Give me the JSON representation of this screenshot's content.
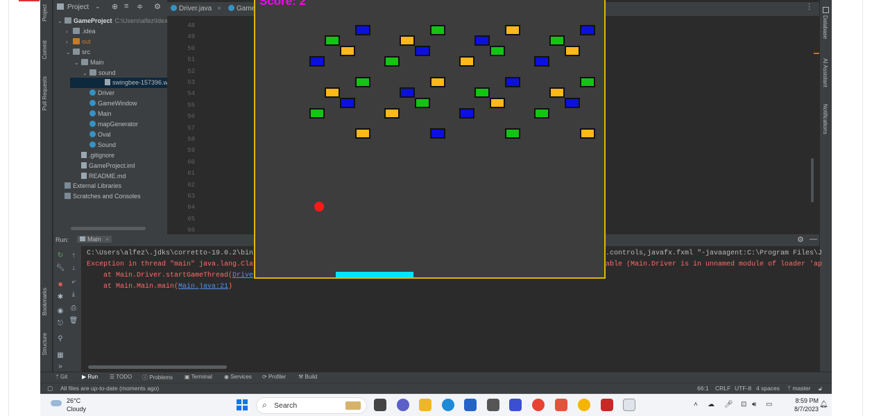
{
  "colors": {
    "game_border": "#e0b800",
    "score": "#ff00ff",
    "ball": "#ff1a1a",
    "paddle": "#00e5ff",
    "brick_blue": "#0b10e0",
    "brick_green": "#14c414",
    "brick_yellow": "#ffb81a"
  },
  "left_strip": {
    "project": "Project",
    "commit": "Commit",
    "pull_requests": "Pull Requests",
    "bookmarks": "Bookmarks",
    "structure": "Structure"
  },
  "right_strip": {
    "database": "Database",
    "ai_assistant": "AI Assistant",
    "notifications": "Notifications"
  },
  "project_panel": {
    "title": "Project",
    "rows": [
      {
        "label": "GameProject",
        "extra": "C:\\Users\\alfez\\IdeaPro",
        "icon": "folder-icon"
      },
      {
        "label": ".idea",
        "icon": "folder-icon"
      },
      {
        "label": "out",
        "icon": "folder-icon"
      },
      {
        "label": "src",
        "icon": "folder-icon"
      },
      {
        "label": "Main",
        "icon": "folder-icon"
      },
      {
        "label": "sound",
        "icon": "folder-icon"
      },
      {
        "label": "swingbee-157396.wav",
        "icon": "file-icon"
      },
      {
        "label": "Driver",
        "icon": "class-icon"
      },
      {
        "label": "GameWindow",
        "icon": "class-icon"
      },
      {
        "label": "Main",
        "icon": "class-icon"
      },
      {
        "label": "mapGenerator",
        "icon": "class-icon"
      },
      {
        "label": "Oval",
        "icon": "class-icon"
      },
      {
        "label": "Sound",
        "icon": "class-icon"
      },
      {
        "label": ".gitignore",
        "icon": "file-icon"
      },
      {
        "label": "GameProject.iml",
        "icon": "file-icon"
      },
      {
        "label": "README.md",
        "icon": "file-icon"
      },
      {
        "label": "External Libraries",
        "icon": "library-icon"
      },
      {
        "label": "Scratches and Consoles",
        "icon": "scratch-icon"
      }
    ]
  },
  "editor": {
    "tabs": [
      "Driver.java",
      "Game"
    ],
    "line_numbers": [
      "48",
      "49",
      "50",
      "51",
      "52",
      "53",
      "54",
      "55",
      "56",
      "57",
      "58",
      "59",
      "60",
      "61",
      "62",
      "63",
      "64",
      "65",
      "66"
    ],
    "code": {
      "line48_kw": "public",
      "line48_rest": " vo",
      "line49_kw": "for",
      "line49_rest": "(i",
      "line50": "f"
    },
    "inspection": "1"
  },
  "run_panel": {
    "label": "Run:",
    "tab": "Main",
    "lines": [
      {
        "text": "C:\\Users\\alfez\\.jdks\\corretto-19.0.2\\bin\\",
        "tail": ".controls,javafx.fxml \"-javaagent:C:\\Program Files\\J"
      },
      {
        "text": "Exception in thread \"main\" java.lang.Cla",
        "tail": "able (Main.Driver is in unnamed module of loader 'ap"
      },
      {
        "text": "    at Main.Driver.startGameThread(",
        "link": "Drive"
      },
      {
        "text": "    at Main.Main.main(",
        "link": "Main.java:21",
        "after": ")"
      }
    ]
  },
  "bottom_tabs": [
    "Git",
    "Run",
    "TODO",
    "Problems",
    "Terminal",
    "Services",
    "Profiler",
    "Build"
  ],
  "status": {
    "message": "All files are up-to-date (moments ago)",
    "position": "66:1",
    "line_sep": "CRLF",
    "encoding": "UTF-8",
    "indent": "4 spaces",
    "branch": "master"
  },
  "game": {
    "score_text": "Score: 2",
    "brick_layout_note": "bricks listed by color",
    "bricks": [
      {
        "c": "blue"
      },
      {
        "c": "green"
      },
      {
        "c": "yellow"
      },
      {
        "c": "blue"
      },
      {
        "c": "green"
      },
      {
        "c": "yellow"
      },
      {
        "c": "blue"
      },
      {
        "c": "blue"
      },
      {
        "c": "green"
      },
      {
        "c": "yellow"
      },
      {
        "c": "green"
      },
      {
        "c": "blue"
      },
      {
        "c": "yellow"
      },
      {
        "c": "green"
      },
      {
        "c": "blue"
      },
      {
        "c": "yellow"
      },
      {
        "c": "green"
      },
      {
        "c": "yellow"
      },
      {
        "c": "green"
      },
      {
        "c": "blue"
      },
      {
        "c": "yellow"
      },
      {
        "c": "blue"
      },
      {
        "c": "green"
      },
      {
        "c": "yellow"
      },
      {
        "c": "blue"
      },
      {
        "c": "green"
      },
      {
        "c": "yellow"
      },
      {
        "c": "blue"
      },
      {
        "c": "green"
      },
      {
        "c": "blue"
      },
      {
        "c": "green"
      },
      {
        "c": "yellow"
      },
      {
        "c": "blue"
      },
      {
        "c": "green"
      },
      {
        "c": "yellow"
      },
      {
        "c": "yellow"
      },
      {
        "c": "blue"
      },
      {
        "c": "green"
      },
      {
        "c": "yellow"
      }
    ]
  },
  "taskbar": {
    "temperature": "26°C",
    "condition": "Cloudy",
    "search_label": "Search",
    "time": "8:59 PM",
    "date": "8/7/2023"
  }
}
